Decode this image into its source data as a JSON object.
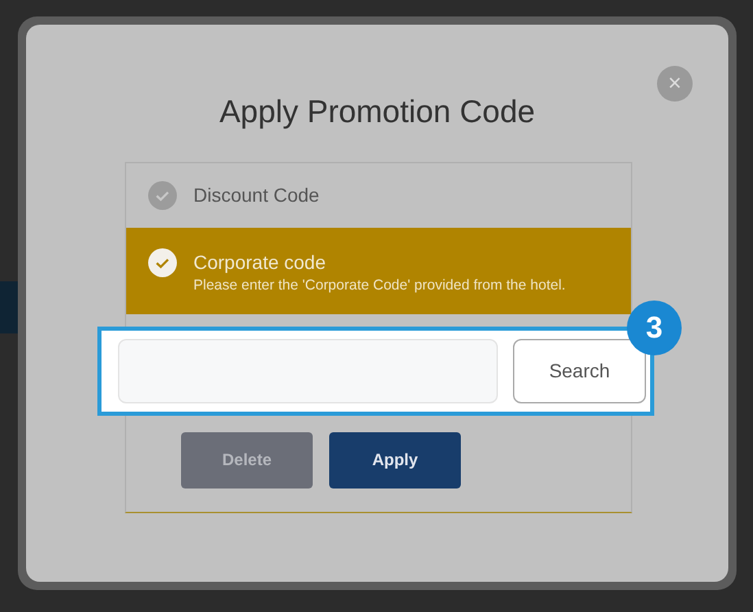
{
  "dialog": {
    "title": "Apply Promotion Code",
    "close": "×"
  },
  "options": [
    {
      "label": "Discount Code",
      "selected": false
    },
    {
      "label": "Corporate code",
      "description": "Please enter the 'Corporate Code' provided from the hotel.",
      "selected": true
    }
  ],
  "search_button": {
    "label": "Search"
  },
  "annotation": {
    "label": "3"
  },
  "buttons": [
    {
      "label": "Delete",
      "kind": "secondary",
      "disabled": true
    },
    {
      "label": "Apply",
      "kind": "primary",
      "disabled": false
    }
  ]
}
